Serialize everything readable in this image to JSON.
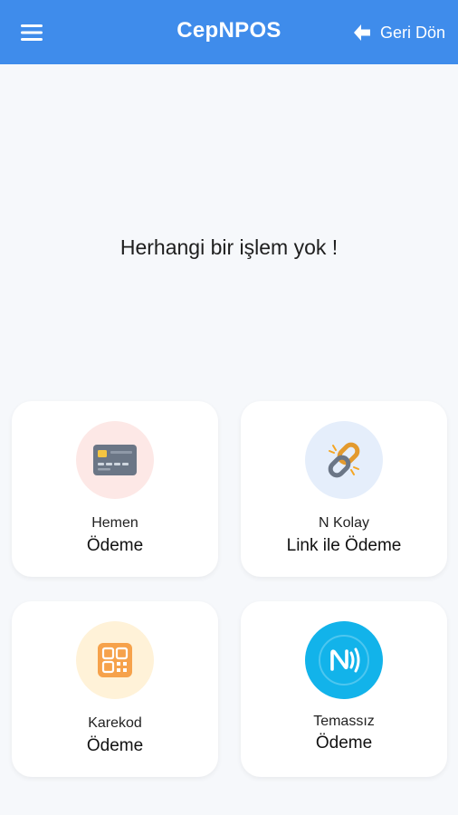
{
  "header": {
    "title": "CepNPOS",
    "back_label": "Geri Dön",
    "menu_icon": "hamburger-menu-icon",
    "back_icon": "arrow-left-icon"
  },
  "main": {
    "empty_message": "Herhangi bir işlem yok !"
  },
  "cards": [
    {
      "line1": "Hemen",
      "line2": "Ödeme",
      "icon": "credit-card-icon"
    },
    {
      "line1": "N Kolay",
      "line2": "Link ile Ödeme",
      "icon": "chain-link-icon"
    },
    {
      "line1": "Karekod",
      "line2": "Ödeme",
      "icon": "qr-code-icon"
    },
    {
      "line1": "Temassız",
      "line2": "Ödeme",
      "icon": "contactless-icon"
    }
  ],
  "colors": {
    "header_bg": "#3f8ceb",
    "page_bg": "#f6f8fb",
    "card_bg": "#ffffff",
    "hemen_circle": "#fde8e6",
    "link_circle": "#e5eefb",
    "karekod_circle": "#fff2d8",
    "temassiz_circle": "#12b3ea"
  }
}
